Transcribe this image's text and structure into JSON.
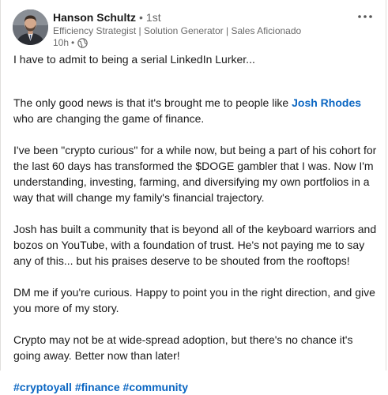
{
  "author": {
    "name": "Hanson Schultz",
    "degree": "1st",
    "headline": "Efficiency Strategist | Solution Generator | Sales Aficionado",
    "time_ago": "10h"
  },
  "icons": {
    "more": "more-horizontal-icon",
    "visibility": "globe-icon"
  },
  "post": {
    "p1": "I have to admit to being a serial LinkedIn Lurker...",
    "p2_before": "The only good news is that it's brought me to people like ",
    "p2_mention": "Josh Rhodes",
    "p2_after": " who are changing the game of finance.",
    "p3": "I've been \"crypto curious\" for a while now, but being a part of his cohort for the last 60 days has transformed the $DOGE gambler that I was. Now I'm understanding, investing, farming, and diversifying my own portfolios in a way that will change my family's financial trajectory.",
    "p4": "Josh has built a community that is beyond all of the keyboard warriors and bozos on YouTube, with a foundation of trust. He's not paying me to say any of this... but his praises deserve to be shouted from the rooftops!",
    "p5": "DM me if you're curious. Happy to point you in the right direction, and give you more of my story.",
    "p6": "Crypto may not be at wide-spread adoption, but there's no chance it's going away. Better now than later!",
    "hashtags": [
      "#cryptoyall",
      "#finance",
      "#community"
    ]
  },
  "colors": {
    "link": "#0a66c2",
    "text": "#191919",
    "secondary_text": "#666666"
  }
}
